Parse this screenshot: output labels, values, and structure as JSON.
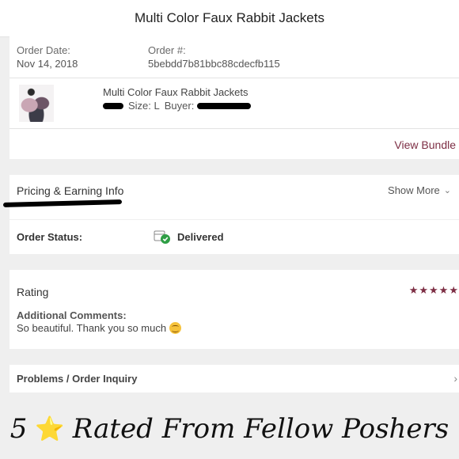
{
  "header": {
    "title": "Multi Color Faux Rabbit Jackets"
  },
  "order": {
    "date_label": "Order Date:",
    "date_value": "Nov 14, 2018",
    "number_label": "Order #:",
    "number_value": "5bebdd7b81bbc88cdecfb115",
    "item_title": "Multi Color Faux Rabbit Jackets",
    "size_text": "Size: L",
    "buyer_label": "Buyer:",
    "view_bundle": "View Bundle"
  },
  "pricing": {
    "title": "Pricing & Earning Info",
    "show_more": "Show More",
    "chevron": "chevron-down-icon"
  },
  "status": {
    "label": "Order Status:",
    "value": "Delivered",
    "icon": "delivered-box-check-icon"
  },
  "rating": {
    "title": "Rating",
    "stars": 5,
    "stars_text": "★★★★★",
    "comments_label": "Additional Comments:",
    "comments_text": "So beautiful. Thank you so much"
  },
  "problems": {
    "label": "Problems / Order Inquiry",
    "chevron": "chevron-right-icon"
  },
  "banner": {
    "number": "5",
    "text": "Rated From Fellow Poshers"
  },
  "colors": {
    "accent": "#7d2e44",
    "background": "#efefef",
    "delivered_green": "#2e9e45"
  }
}
